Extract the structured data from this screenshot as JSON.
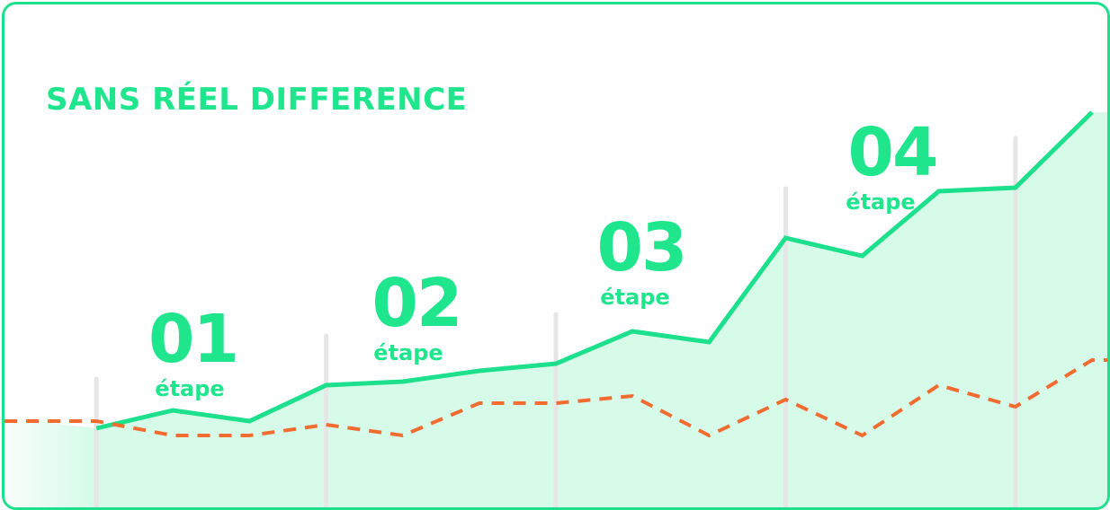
{
  "title": "SANS RÉEL DIFFERENCE",
  "steps": [
    {
      "number": "01",
      "label": "étape"
    },
    {
      "number": "02",
      "label": "étape"
    },
    {
      "number": "03",
      "label": "étape"
    },
    {
      "number": "04",
      "label": "étape"
    }
  ],
  "chart_data": {
    "type": "line",
    "title": "SANS RÉEL DIFFERENCE",
    "xlabel": "",
    "ylabel": "",
    "x": [
      0,
      1,
      2,
      3,
      4,
      5,
      6,
      7,
      8,
      9,
      10,
      11,
      12,
      13
    ],
    "xlim": [
      -1.2,
      13.2
    ],
    "ylim": [
      0,
      100
    ],
    "grid": false,
    "series": [
      {
        "style": "solid",
        "fill": true,
        "color": "#1de08c",
        "values": [
          12,
          17,
          14,
          24,
          25,
          28,
          30,
          39,
          36,
          65,
          60,
          78,
          79,
          100
        ]
      },
      {
        "style": "dashed",
        "fill": false,
        "color": "#f26b2f",
        "values": [
          14,
          10,
          10,
          13,
          10,
          19,
          19,
          21,
          10,
          20,
          10,
          24,
          18,
          31
        ]
      }
    ],
    "series_start": [
      15,
      null
    ],
    "step_markers": [
      0,
      3,
      6,
      9,
      12
    ],
    "colors": {
      "accent": "#1fe58d",
      "fill": "#d6fbe9",
      "dashed": "#f26b2f",
      "marker": "#e6e6e6"
    }
  }
}
